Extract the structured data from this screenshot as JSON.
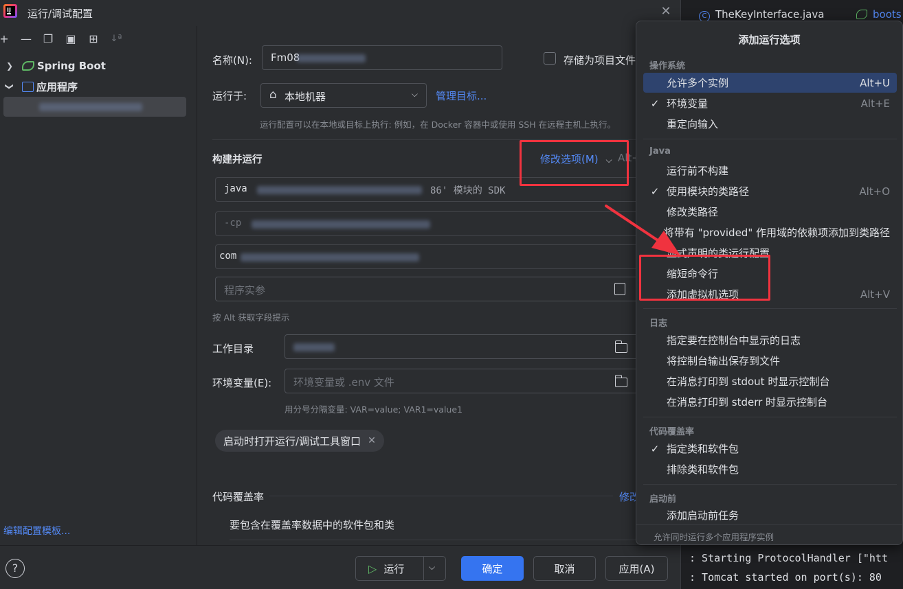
{
  "window": {
    "title": "运行/调试配置"
  },
  "sidebar": {
    "tree": [
      {
        "label": "Spring Boot",
        "icon": "spring-boot-icon"
      },
      {
        "label": "应用程序",
        "icon": "application-icon"
      }
    ],
    "edit_templates_link": "编辑配置模板..."
  },
  "form": {
    "name_label": "名称(N):",
    "name_value": "Fm08",
    "store_as_project_file": "存储为项目文件",
    "run_on_label": "运行于:",
    "run_on_value": "本地机器",
    "manage_targets": "管理目标...",
    "run_on_hint": "运行配置可以在本地或目标上执行: 例如，在 Docker 容器中或使用 SSH 在远程主机上执行。",
    "build_run_header": "构建并运行",
    "modify_options": "修改选项(M)",
    "modify_options_shortcut": "Alt+",
    "sdk_value_prefix": "java",
    "sdk_value_suffix": "86' 模块的 SDK",
    "classpath_prefix": "-cp",
    "main_class_prefix": "com",
    "program_args_placeholder": "程序实参",
    "alt_hint": "按 Alt 获取字段提示",
    "workdir_label": "工作目录",
    "env_label": "环境变量(E):",
    "env_placeholder": "环境变量或 .env 文件",
    "env_hint": "用分号分隔变量: VAR=value; VAR1=value1",
    "chip_label": "启动时打开运行/调试工具窗口",
    "coverage_header": "代码覆盖率",
    "coverage_modify": "修改",
    "coverage_sub": "要包含在覆盖率数据中的软件包和类"
  },
  "buttons": {
    "run": "运行",
    "ok": "确定",
    "cancel": "取消",
    "apply": "应用(A)",
    "help": "?"
  },
  "editor": {
    "tab1": "TheKeyInterface.java",
    "tab2": "boots",
    "console": [
      ": Starting ProtocolHandler [\"htt",
      ": Tomcat started on port(s): 80"
    ]
  },
  "popup": {
    "title": "添加运行选项",
    "sections": [
      {
        "header": "操作系统",
        "items": [
          {
            "label": "允许多个实例",
            "shortcut": "Alt+U",
            "checked": false,
            "active": true
          },
          {
            "label": "环境变量",
            "shortcut": "Alt+E",
            "checked": true
          },
          {
            "label": "重定向输入",
            "shortcut": "",
            "checked": false
          }
        ]
      },
      {
        "header": "Java",
        "items": [
          {
            "label": "运行前不构建",
            "shortcut": "",
            "checked": false
          },
          {
            "label": "使用模块的类路径",
            "shortcut": "Alt+O",
            "checked": true
          },
          {
            "label": "修改类路径",
            "shortcut": "",
            "checked": false
          },
          {
            "label": "将带有 \"provided\" 作用域的依赖项添加到类路径",
            "shortcut": "",
            "checked": false
          },
          {
            "label": "显式声明的类运行配置",
            "shortcut": "",
            "checked": false
          },
          {
            "label": "缩短命令行",
            "shortcut": "",
            "checked": false
          },
          {
            "label": "添加虚拟机选项",
            "shortcut": "Alt+V",
            "checked": false
          }
        ]
      },
      {
        "header": "日志",
        "items": [
          {
            "label": "指定要在控制台中显示的日志",
            "shortcut": "",
            "checked": false
          },
          {
            "label": "将控制台输出保存到文件",
            "shortcut": "",
            "checked": false
          },
          {
            "label": "在消息打印到 stdout 时显示控制台",
            "shortcut": "",
            "checked": false
          },
          {
            "label": "在消息打印到 stderr 时显示控制台",
            "shortcut": "",
            "checked": false
          }
        ]
      },
      {
        "header": "代码覆盖率",
        "items": [
          {
            "label": "指定类和软件包",
            "shortcut": "",
            "checked": true
          },
          {
            "label": "排除类和软件包",
            "shortcut": "",
            "checked": false
          }
        ]
      },
      {
        "header": "启动前",
        "items": [
          {
            "label": "添加启动前任务",
            "shortcut": "",
            "checked": false
          }
        ]
      }
    ],
    "footer": "允许同时运行多个应用程序实例"
  },
  "colors": {
    "accent": "#3574f0",
    "link": "#548af7",
    "annotation_red": "#f0333f",
    "active_row": "#2e436e"
  }
}
